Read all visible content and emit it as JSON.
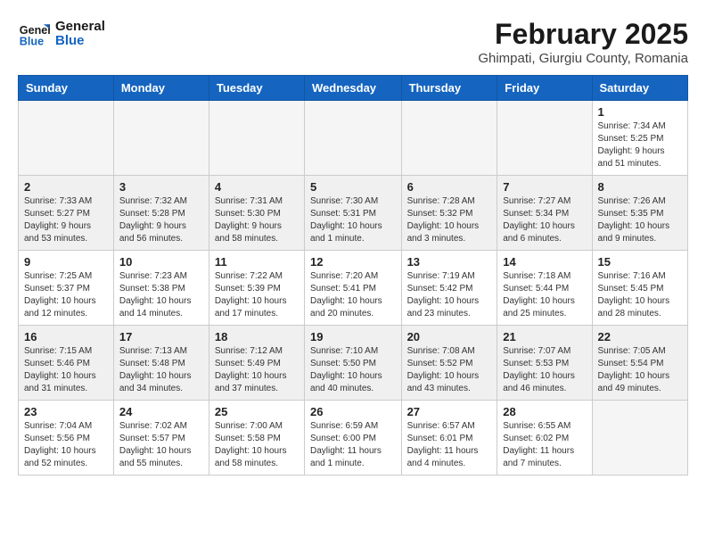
{
  "header": {
    "logo_line1": "General",
    "logo_line2": "Blue",
    "title": "February 2025",
    "subtitle": "Ghimpati, Giurgiu County, Romania"
  },
  "weekdays": [
    "Sunday",
    "Monday",
    "Tuesday",
    "Wednesday",
    "Thursday",
    "Friday",
    "Saturday"
  ],
  "weeks": [
    [
      {
        "day": "",
        "info": ""
      },
      {
        "day": "",
        "info": ""
      },
      {
        "day": "",
        "info": ""
      },
      {
        "day": "",
        "info": ""
      },
      {
        "day": "",
        "info": ""
      },
      {
        "day": "",
        "info": ""
      },
      {
        "day": "1",
        "info": "Sunrise: 7:34 AM\nSunset: 5:25 PM\nDaylight: 9 hours and 51 minutes."
      }
    ],
    [
      {
        "day": "2",
        "info": "Sunrise: 7:33 AM\nSunset: 5:27 PM\nDaylight: 9 hours and 53 minutes."
      },
      {
        "day": "3",
        "info": "Sunrise: 7:32 AM\nSunset: 5:28 PM\nDaylight: 9 hours and 56 minutes."
      },
      {
        "day": "4",
        "info": "Sunrise: 7:31 AM\nSunset: 5:30 PM\nDaylight: 9 hours and 58 minutes."
      },
      {
        "day": "5",
        "info": "Sunrise: 7:30 AM\nSunset: 5:31 PM\nDaylight: 10 hours and 1 minute."
      },
      {
        "day": "6",
        "info": "Sunrise: 7:28 AM\nSunset: 5:32 PM\nDaylight: 10 hours and 3 minutes."
      },
      {
        "day": "7",
        "info": "Sunrise: 7:27 AM\nSunset: 5:34 PM\nDaylight: 10 hours and 6 minutes."
      },
      {
        "day": "8",
        "info": "Sunrise: 7:26 AM\nSunset: 5:35 PM\nDaylight: 10 hours and 9 minutes."
      }
    ],
    [
      {
        "day": "9",
        "info": "Sunrise: 7:25 AM\nSunset: 5:37 PM\nDaylight: 10 hours and 12 minutes."
      },
      {
        "day": "10",
        "info": "Sunrise: 7:23 AM\nSunset: 5:38 PM\nDaylight: 10 hours and 14 minutes."
      },
      {
        "day": "11",
        "info": "Sunrise: 7:22 AM\nSunset: 5:39 PM\nDaylight: 10 hours and 17 minutes."
      },
      {
        "day": "12",
        "info": "Sunrise: 7:20 AM\nSunset: 5:41 PM\nDaylight: 10 hours and 20 minutes."
      },
      {
        "day": "13",
        "info": "Sunrise: 7:19 AM\nSunset: 5:42 PM\nDaylight: 10 hours and 23 minutes."
      },
      {
        "day": "14",
        "info": "Sunrise: 7:18 AM\nSunset: 5:44 PM\nDaylight: 10 hours and 25 minutes."
      },
      {
        "day": "15",
        "info": "Sunrise: 7:16 AM\nSunset: 5:45 PM\nDaylight: 10 hours and 28 minutes."
      }
    ],
    [
      {
        "day": "16",
        "info": "Sunrise: 7:15 AM\nSunset: 5:46 PM\nDaylight: 10 hours and 31 minutes."
      },
      {
        "day": "17",
        "info": "Sunrise: 7:13 AM\nSunset: 5:48 PM\nDaylight: 10 hours and 34 minutes."
      },
      {
        "day": "18",
        "info": "Sunrise: 7:12 AM\nSunset: 5:49 PM\nDaylight: 10 hours and 37 minutes."
      },
      {
        "day": "19",
        "info": "Sunrise: 7:10 AM\nSunset: 5:50 PM\nDaylight: 10 hours and 40 minutes."
      },
      {
        "day": "20",
        "info": "Sunrise: 7:08 AM\nSunset: 5:52 PM\nDaylight: 10 hours and 43 minutes."
      },
      {
        "day": "21",
        "info": "Sunrise: 7:07 AM\nSunset: 5:53 PM\nDaylight: 10 hours and 46 minutes."
      },
      {
        "day": "22",
        "info": "Sunrise: 7:05 AM\nSunset: 5:54 PM\nDaylight: 10 hours and 49 minutes."
      }
    ],
    [
      {
        "day": "23",
        "info": "Sunrise: 7:04 AM\nSunset: 5:56 PM\nDaylight: 10 hours and 52 minutes."
      },
      {
        "day": "24",
        "info": "Sunrise: 7:02 AM\nSunset: 5:57 PM\nDaylight: 10 hours and 55 minutes."
      },
      {
        "day": "25",
        "info": "Sunrise: 7:00 AM\nSunset: 5:58 PM\nDaylight: 10 hours and 58 minutes."
      },
      {
        "day": "26",
        "info": "Sunrise: 6:59 AM\nSunset: 6:00 PM\nDaylight: 11 hours and 1 minute."
      },
      {
        "day": "27",
        "info": "Sunrise: 6:57 AM\nSunset: 6:01 PM\nDaylight: 11 hours and 4 minutes."
      },
      {
        "day": "28",
        "info": "Sunrise: 6:55 AM\nSunset: 6:02 PM\nDaylight: 11 hours and 7 minutes."
      },
      {
        "day": "",
        "info": ""
      }
    ]
  ]
}
